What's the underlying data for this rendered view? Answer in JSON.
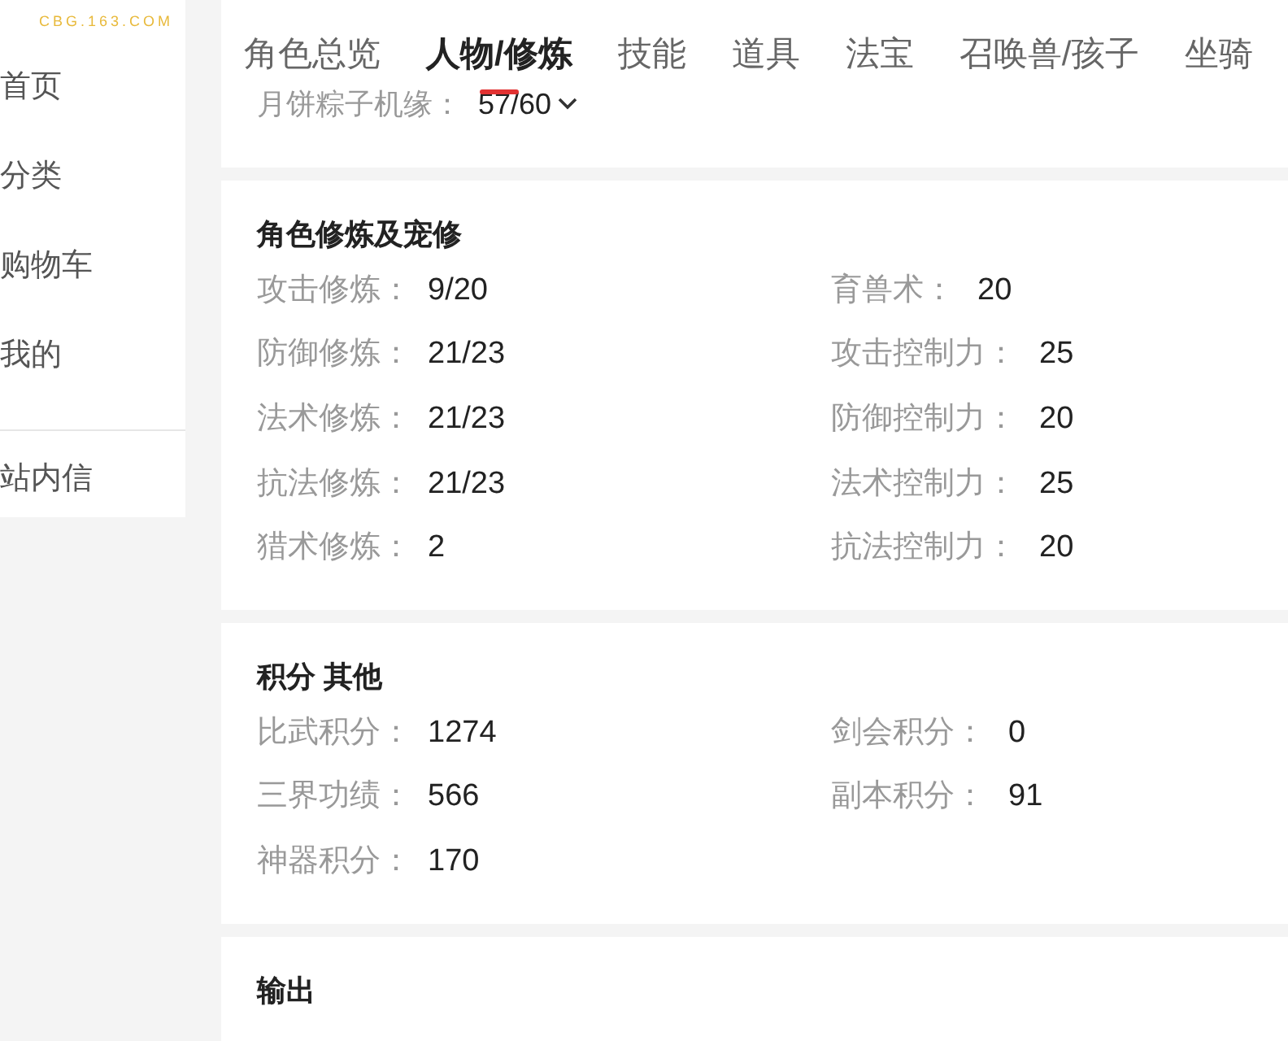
{
  "logo": {
    "text": "CBG.163.COM"
  },
  "sidebar": {
    "items": [
      {
        "label": "首页",
        "divider_before": false
      },
      {
        "label": "分类",
        "divider_before": false
      },
      {
        "label": "购物车",
        "divider_before": false
      },
      {
        "label": "我的",
        "divider_before": false
      },
      {
        "label": "站内信",
        "divider_before": true
      }
    ]
  },
  "tabs": [
    {
      "label": "角色总览",
      "selected": false
    },
    {
      "label": "人物/修炼",
      "selected": true
    },
    {
      "label": "技能",
      "selected": false
    },
    {
      "label": "道具",
      "selected": false
    },
    {
      "label": "法宝",
      "selected": false
    },
    {
      "label": "召唤兽/孩子",
      "selected": false
    },
    {
      "label": "坐骑",
      "selected": false
    }
  ],
  "header_field": {
    "label": "月饼粽子机缘：",
    "value": "57/60"
  },
  "sections": [
    {
      "title": "角色修炼及宠修",
      "left": [
        {
          "label": "攻击修炼：",
          "value": "9/20"
        },
        {
          "label": "防御修炼：",
          "value": "21/23"
        },
        {
          "label": "法术修炼：",
          "value": "21/23"
        },
        {
          "label": "抗法修炼：",
          "value": "21/23"
        },
        {
          "label": "猎术修炼：",
          "value": "2"
        }
      ],
      "right": [
        {
          "label": "育兽术：",
          "value": "20"
        },
        {
          "label": "攻击控制力：",
          "value": "25"
        },
        {
          "label": "防御控制力：",
          "value": "20"
        },
        {
          "label": "法术控制力：",
          "value": "25"
        },
        {
          "label": "抗法控制力：",
          "value": "20"
        }
      ]
    },
    {
      "title": "积分 其他",
      "left": [
        {
          "label": "比武积分：",
          "value": "1274"
        },
        {
          "label": "三界功绩：",
          "value": "566"
        },
        {
          "label": "神器积分：",
          "value": "170"
        }
      ],
      "right": [
        {
          "label": "剑会积分：",
          "value": "0"
        },
        {
          "label": "副本积分：",
          "value": "91"
        }
      ]
    },
    {
      "title": "输出"
    }
  ]
}
